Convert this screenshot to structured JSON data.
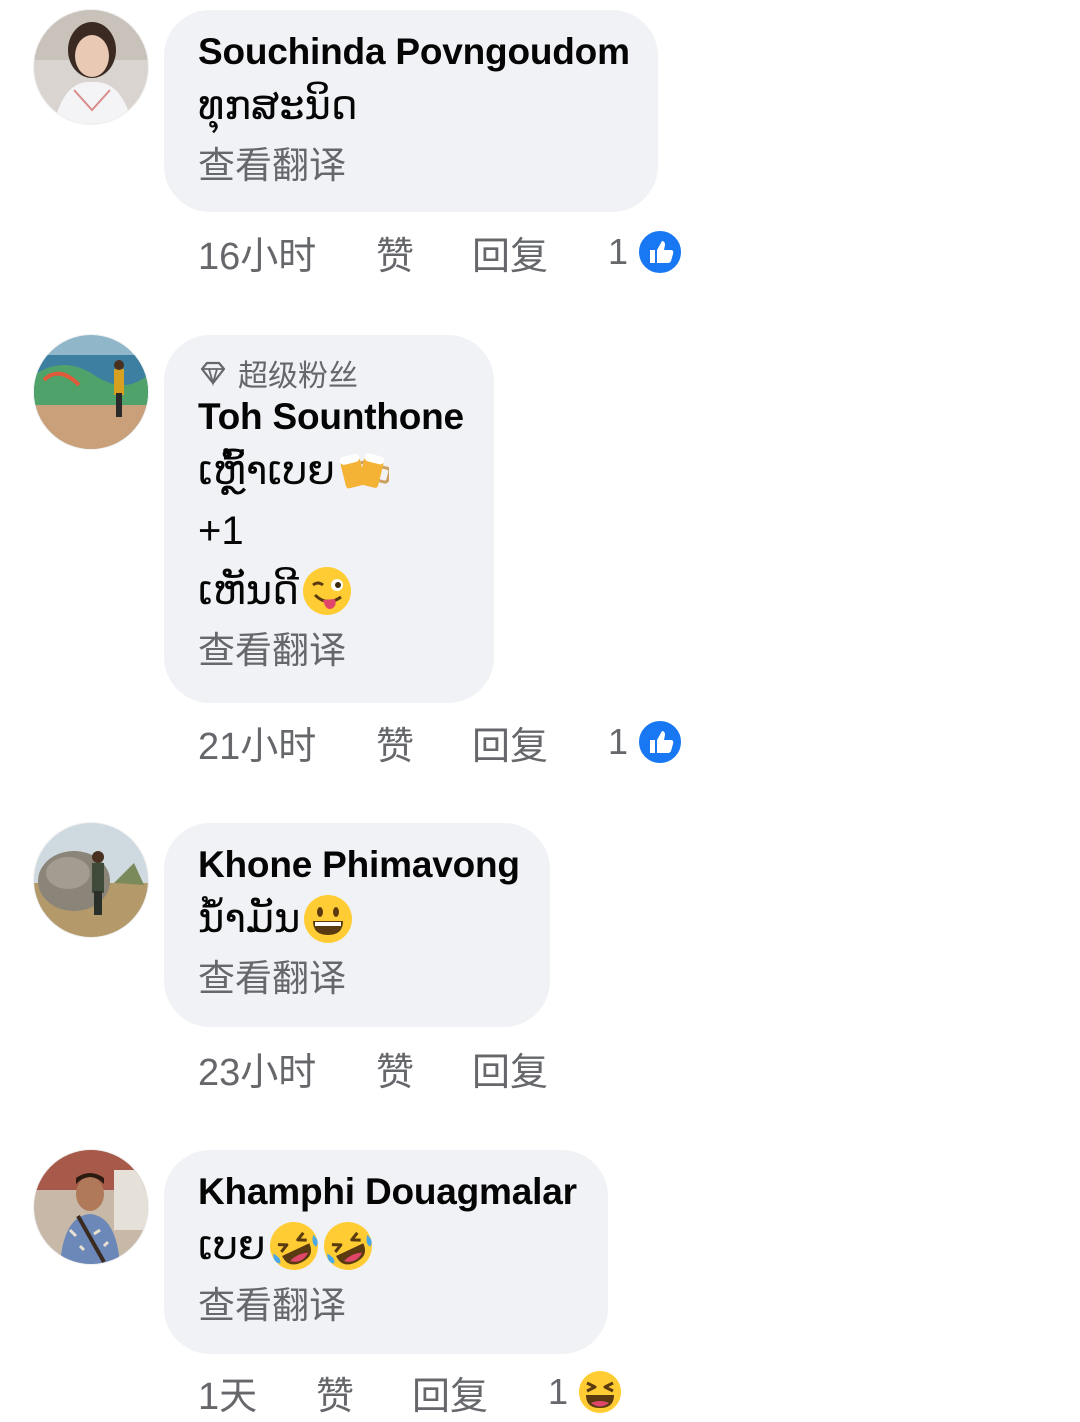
{
  "comments": [
    {
      "author": "Souchinda Povngoudom",
      "lines": [
        {
          "text": "ທຸກສະນິດ",
          "emoji": []
        }
      ],
      "see_translation": "查看翻译",
      "time": "16小时",
      "like_label": "赞",
      "reply_label": "回复",
      "reaction_count": "1",
      "reaction_icon": "thumbs-up-icon"
    },
    {
      "badge": "超级粉丝",
      "badge_icon": "diamond-icon",
      "author": "Toh Sounthone",
      "lines": [
        {
          "text": "ເຫຼົ້າເບຍ",
          "emoji": [
            "beer-mugs-emoji"
          ]
        },
        {
          "text": "+1",
          "emoji": []
        },
        {
          "text": "ເຫັນດີ",
          "emoji": [
            "winking-tongue-emoji"
          ]
        }
      ],
      "see_translation": "查看翻译",
      "time": "21小时",
      "like_label": "赞",
      "reply_label": "回复",
      "reaction_count": "1",
      "reaction_icon": "thumbs-up-icon"
    },
    {
      "author": "Khone Phimavong",
      "lines": [
        {
          "text": "ນ້ຳມັນ",
          "emoji": [
            "grinning-face-emoji"
          ]
        }
      ],
      "see_translation": "查看翻译",
      "time": "23小时",
      "like_label": "赞",
      "reply_label": "回复"
    },
    {
      "author": "Khamphi Douagmalar",
      "lines": [
        {
          "text": "ເບຍ",
          "emoji": [
            "rolling-laughing-emoji",
            "rolling-laughing-emoji"
          ]
        }
      ],
      "see_translation": "查看翻译",
      "time": "1天",
      "like_label": "赞",
      "reply_label": "回复",
      "reaction_count": "1",
      "reaction_icon": "haha-reaction-icon"
    }
  ],
  "colors": {
    "bubble": "#f0f2f5",
    "secondary_text": "#65676b",
    "like_blue": "#1877f2",
    "emoji_yellow": "#ffcc33"
  }
}
